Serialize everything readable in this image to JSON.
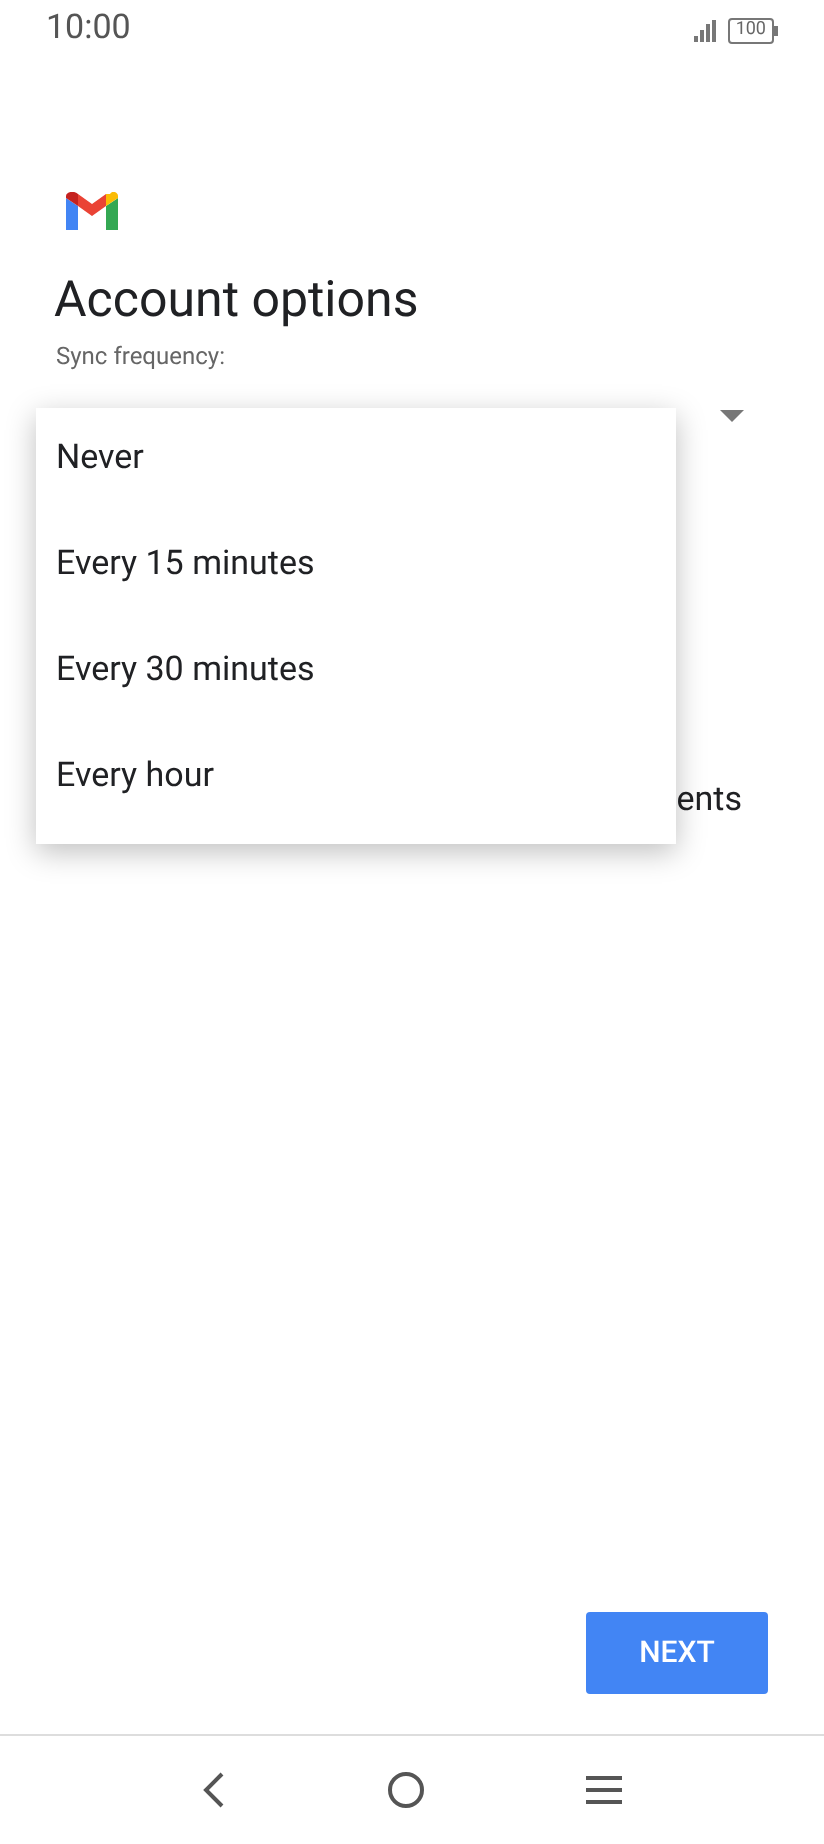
{
  "status_bar": {
    "time": "10:00",
    "battery": "100"
  },
  "title": "Account options",
  "sync_frequency": {
    "label": "Sync frequency:"
  },
  "dropdown_menu": {
    "options": [
      "Never",
      "Every 15 minutes",
      "Every 30 minutes",
      "Every hour"
    ]
  },
  "partly_hidden_option": {
    "line_1": "ents"
  },
  "next_button": "NEXT"
}
